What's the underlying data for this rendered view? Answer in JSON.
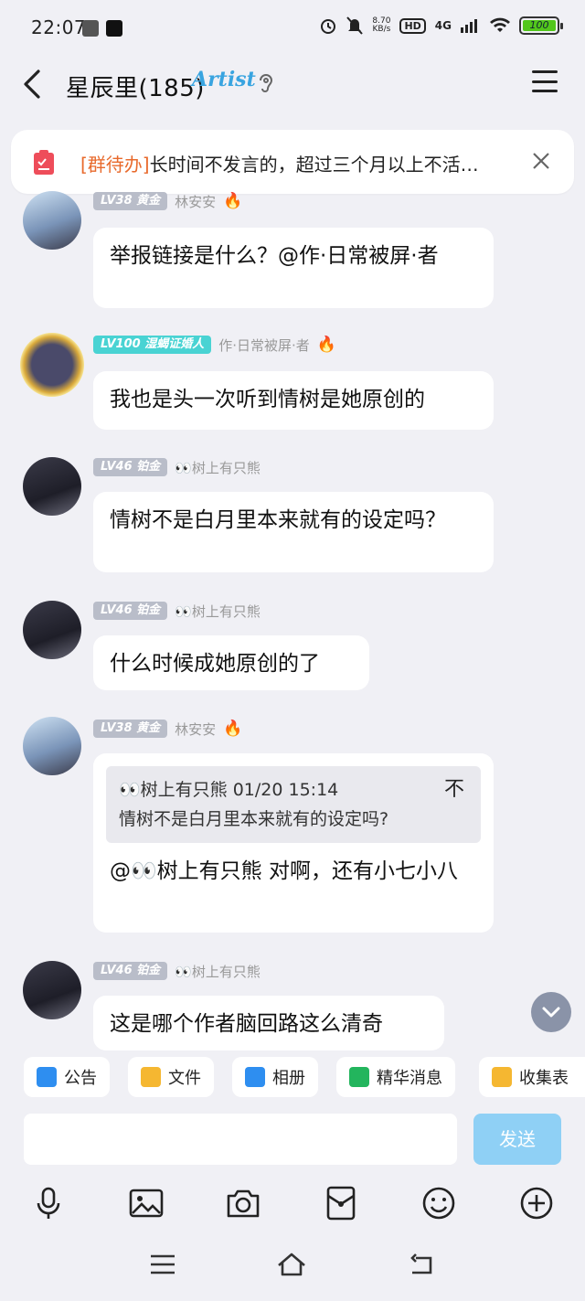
{
  "status": {
    "time": "22:07",
    "speed_value": "8.70",
    "speed_unit": "KB/s",
    "hd": "HD",
    "network": "4G",
    "battery": "100"
  },
  "header": {
    "title": "星辰里(185)",
    "badge": "Artist"
  },
  "todo": {
    "tag": "[群待办]",
    "text": "长时间不发言的，超过三个月以上不活…"
  },
  "messages": [
    {
      "level": "LV38 黄金",
      "name": "林安安",
      "text": "举报链接是什么？@作·日常被屏·者"
    },
    {
      "level": "LV100 湿蝎证婚人",
      "name": "作·日常被屏·者",
      "text": "我也是头一次听到情树是她原创的"
    },
    {
      "level": "LV46 铂金",
      "name": "👀树上有只熊",
      "text": "情树不是白月里本来就有的设定吗？"
    },
    {
      "level": "LV46 铂金",
      "name": "👀树上有只熊",
      "text": "什么时候成她原创的了"
    },
    {
      "level": "LV38 黄金",
      "name": "林安安",
      "quote_head": "👀树上有只熊 01/20 15:14",
      "quote_pin": "不",
      "quote_text": "情树不是白月里本来就有的设定吗?",
      "text": "@👀树上有只熊 对啊，还有小七小八"
    },
    {
      "level": "LV46 铂金",
      "name": "👀树上有只熊",
      "text": "这是哪个作者脑回路这么清奇"
    }
  ],
  "quick_actions": [
    "公告",
    "文件",
    "相册",
    "精华消息",
    "收集表"
  ],
  "input": {
    "placeholder": "",
    "send_label": "发送"
  },
  "colors": {
    "accent": "#8fd0f5",
    "tag": "#e86a2c",
    "level_cyan": "#49d3d3",
    "level_gray": "#b9bdc9"
  }
}
